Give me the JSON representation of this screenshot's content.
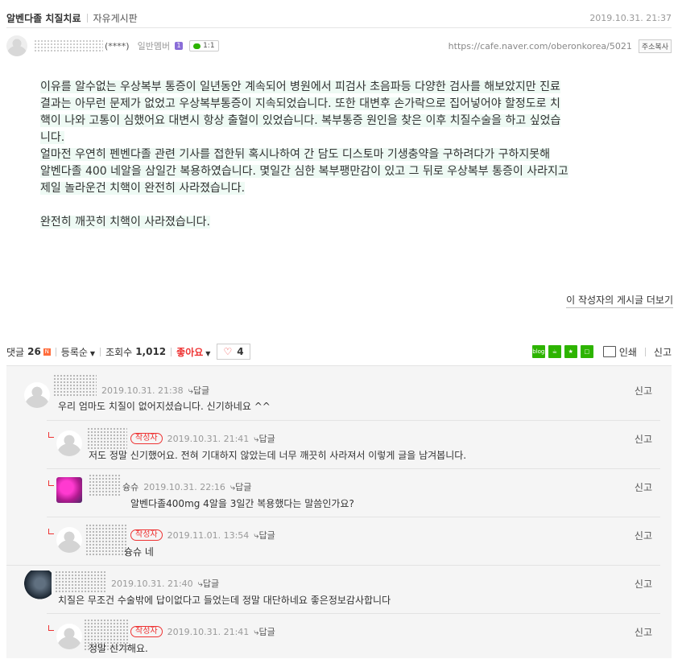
{
  "header": {
    "post_title": "알벤다졸 치질치료",
    "board_name": "자유게시판",
    "datetime": "2019.10.31. 21:37"
  },
  "author": {
    "nick_suffix": "(****)",
    "member_level": "일반멤버",
    "level_badge": "1",
    "chat_label": "1:1",
    "url": "https://cafe.naver.com/oberonkorea/5021",
    "copy_label": "주소복사"
  },
  "article": {
    "paragraph1": [
      "이유를 알수없는 우상복부 통증이 일년동안 계속되어 병원에서 피검사 초음파등 다양한 검사를 해보았지만 진료",
      "결과는 아무런 문제가 없었고 우상복부통증이 지속되었습니다. 또한 대변후 손가락으로 집어넣어야 할정도로 치",
      "핵이 나와 고통이 심했어요 대변시 항상 출혈이 있었습니다. 복부통증 원인을 찾은 이후 치질수술을 하고 싶었습",
      "니다.",
      "얼마전 우연히 펜벤다졸 관련 기사를 접한뒤 혹시나하여 간 담도 디스토마 기생충약을 구하려다가 구하지못해",
      "알벤다졸 400 네알을 삼일간 복용하였습니다. 몇일간 심한 복부팽만감이 있고 그 뒤로 우상복부 통증이 사라지고",
      "제일 놀라운건 치핵이 완전히 사라졌습니다."
    ],
    "paragraph2": "완전히 깨끗히 치핵이 사라졌습니다."
  },
  "more_posts_link": "이 작성자의 게시글 더보기",
  "stats": {
    "comments_label": "댓글",
    "comments_count": "26",
    "new_badge": "N",
    "sort_label": "등록순",
    "views_label": "조회수",
    "views_count": "1,012",
    "like_label": "좋아요",
    "heart_count": "4",
    "share_blog": "blog",
    "print_label": "인쇄",
    "report_label": "신고"
  },
  "comments": [
    {
      "nick_tail": "",
      "datetime": "2019.10.31. 21:38",
      "reply": "답글",
      "author_tag": "",
      "text": "우리 엄마도 치질이 없어지셨습니다. 신기하네요 ^^",
      "report": "신고"
    },
    {
      "nick_tail": "",
      "datetime": "2019.10.31. 21:41",
      "reply": "답글",
      "author_tag": "작성자",
      "text": "저도 정말 신기했어요. 전혀 기대하지 않았는데 너무 깨끗히 사라져서 이렇게 글을 남겨봅니다.",
      "report": "신고"
    },
    {
      "nick_tail": "슝슈",
      "datetime": "2019.10.31. 22:16",
      "reply": "답글",
      "author_tag": "",
      "text": "알벤다졸400mg 4알을 3일간 복용했다는 말씀인가요?",
      "report": "신고"
    },
    {
      "nick_tail": "",
      "datetime": "2019.11.01. 13:54",
      "reply": "답글",
      "author_tag": "작성자",
      "text": "슝슈 네",
      "report": "신고"
    },
    {
      "nick_tail": "",
      "datetime": "2019.10.31. 21:40",
      "reply": "답글",
      "author_tag": "",
      "text": "치질은 무조건 수술밖에 답이없다고 들었는데 정말 대단하네요 좋은정보감사합니다",
      "report": "신고"
    },
    {
      "nick_tail": "",
      "datetime": "2019.10.31. 21:41",
      "reply": "답글",
      "author_tag": "작성자",
      "text": "정말 신기해요.",
      "report": "신고"
    }
  ]
}
